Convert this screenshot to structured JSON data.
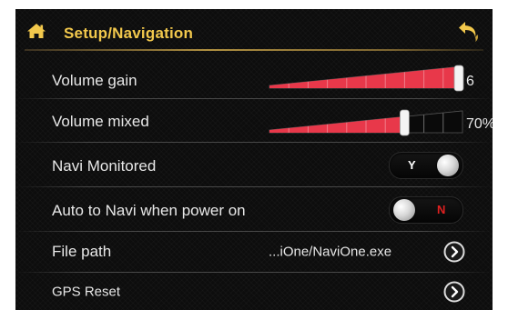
{
  "header": {
    "title": "Setup/Navigation",
    "home_icon": "home-icon",
    "back_icon": "back-arrow-icon",
    "accent_color": "#f2c84c"
  },
  "rows": {
    "volume_gain": {
      "label": "Volume gain",
      "value_text": "6",
      "level": 1.0
    },
    "volume_mixed": {
      "label": "Volume mixed",
      "value_text": "70%",
      "level": 0.7
    },
    "navi_monitored": {
      "label": "Navi Monitored",
      "state_text": "Y",
      "on": true
    },
    "auto_to_navi": {
      "label": "Auto to Navi when power on",
      "state_text": "N",
      "on": false
    },
    "file_path": {
      "label": "File path",
      "value": "...iOne/NaviOne.exe",
      "icon": "chevron-right-circle-icon"
    },
    "gps_reset": {
      "label": "GPS Reset",
      "icon": "chevron-right-circle-icon"
    }
  },
  "colors": {
    "slider_fill": "#e8384a",
    "toggle_on_text": "#ffffff",
    "toggle_off_text": "#e02020"
  }
}
